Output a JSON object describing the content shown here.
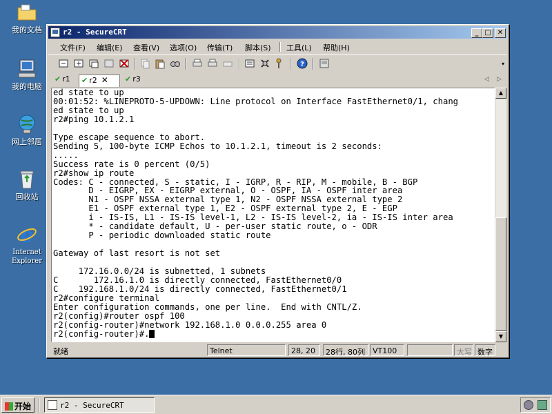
{
  "desktop": {
    "icons": [
      {
        "label": "我的文档",
        "icon": "folder-icon"
      },
      {
        "label": "我的电脑",
        "icon": "computer-icon"
      },
      {
        "label": "网上邻居",
        "icon": "network-icon"
      },
      {
        "label": "回收站",
        "icon": "recycle-bin-icon"
      },
      {
        "label": "Internet\nExplorer",
        "icon": "ie-icon"
      }
    ]
  },
  "window": {
    "title": "r2 - SecureCRT",
    "menu": [
      "文件(F)",
      "编辑(E)",
      "查看(V)",
      "选项(O)",
      "传输(T)",
      "脚本(S)",
      "工具(L)",
      "帮助(H)"
    ],
    "tabs": [
      "r1",
      "r2",
      "r3"
    ],
    "active_tab": "r2",
    "terminal_lines": [
      "ed state to up",
      "00:01:52: %LINEPROTO-5-UPDOWN: Line protocol on Interface FastEthernet0/1, chang",
      "ed state to up",
      "r2#ping 10.1.2.1",
      "",
      "Type escape sequence to abort.",
      "Sending 5, 100-byte ICMP Echos to 10.1.2.1, timeout is 2 seconds:",
      ".....",
      "Success rate is 0 percent (0/5)",
      "r2#show ip route",
      "Codes: C - connected, S - static, I - IGRP, R - RIP, M - mobile, B - BGP",
      "       D - EIGRP, EX - EIGRP external, O - OSPF, IA - OSPF inter area",
      "       N1 - OSPF NSSA external type 1, N2 - OSPF NSSA external type 2",
      "       E1 - OSPF external type 1, E2 - OSPF external type 2, E - EGP",
      "       i - IS-IS, L1 - IS-IS level-1, L2 - IS-IS level-2, ia - IS-IS inter area",
      "       * - candidate default, U - per-user static route, o - ODR",
      "       P - periodic downloaded static route",
      "",
      "Gateway of last resort is not set",
      "",
      "     172.16.0.0/24 is subnetted, 1 subnets",
      "C       172.16.1.0 is directly connected, FastEthernet0/0",
      "C    192.168.1.0/24 is directly connected, FastEthernet0/1",
      "r2#configure terminal",
      "Enter configuration commands, one per line.  End with CNTL/Z.",
      "r2(config)#router ospf 100",
      "r2(config-router)#network 192.168.1.0 0.0.0.255 area 0",
      "r2(config-router)#."
    ],
    "status": {
      "ready": "就绪",
      "protocol": "Telnet",
      "cursor_pos": "28, 20",
      "size": "28行, 80列",
      "emulation": "VT100",
      "caps": "大写",
      "num": "数字"
    }
  },
  "taskbar": {
    "start_label": "开始",
    "task_label": "r2 - SecureCRT"
  }
}
